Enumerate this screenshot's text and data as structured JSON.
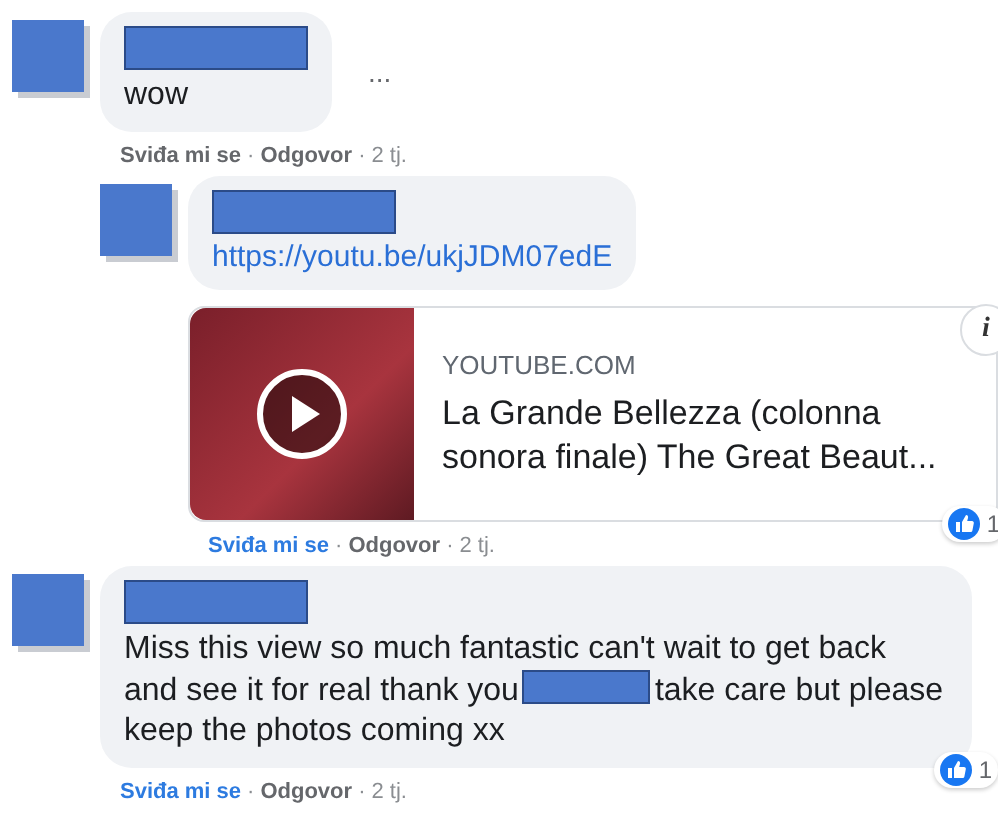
{
  "comments": [
    {
      "indent": false,
      "segments": [
        {
          "kind": "text",
          "text": "wow"
        }
      ],
      "more": "...",
      "liked": false,
      "like": "Sviđa mi se",
      "separator": "·",
      "reply": "Odgovor",
      "time": "2 tj."
    },
    {
      "indent": true,
      "segments": [
        {
          "kind": "link",
          "text": "https://youtu.be/ukjJDM07edE"
        }
      ],
      "liked": true,
      "like": "Sviđa mi se",
      "separator": "·",
      "reply": "Odgovor",
      "time": "2 tj.",
      "reactions": "1",
      "preview": {
        "domain": "YOUTUBE.COM",
        "title": "La Grande Bellezza (colonna sonora finale) The Great Beaut...",
        "info": "i"
      }
    },
    {
      "indent": false,
      "segments": [
        {
          "kind": "text",
          "text": "Miss this view so much fantastic can't wait to get back and see it for real thank you"
        },
        {
          "kind": "redacted"
        },
        {
          "kind": "text",
          "text": "take care but please keep the photos coming xx"
        }
      ],
      "liked": true,
      "like": "Sviđa mi se",
      "separator": "·",
      "reply": "Odgovor",
      "time": "2 tj.",
      "reactions": "1"
    }
  ]
}
